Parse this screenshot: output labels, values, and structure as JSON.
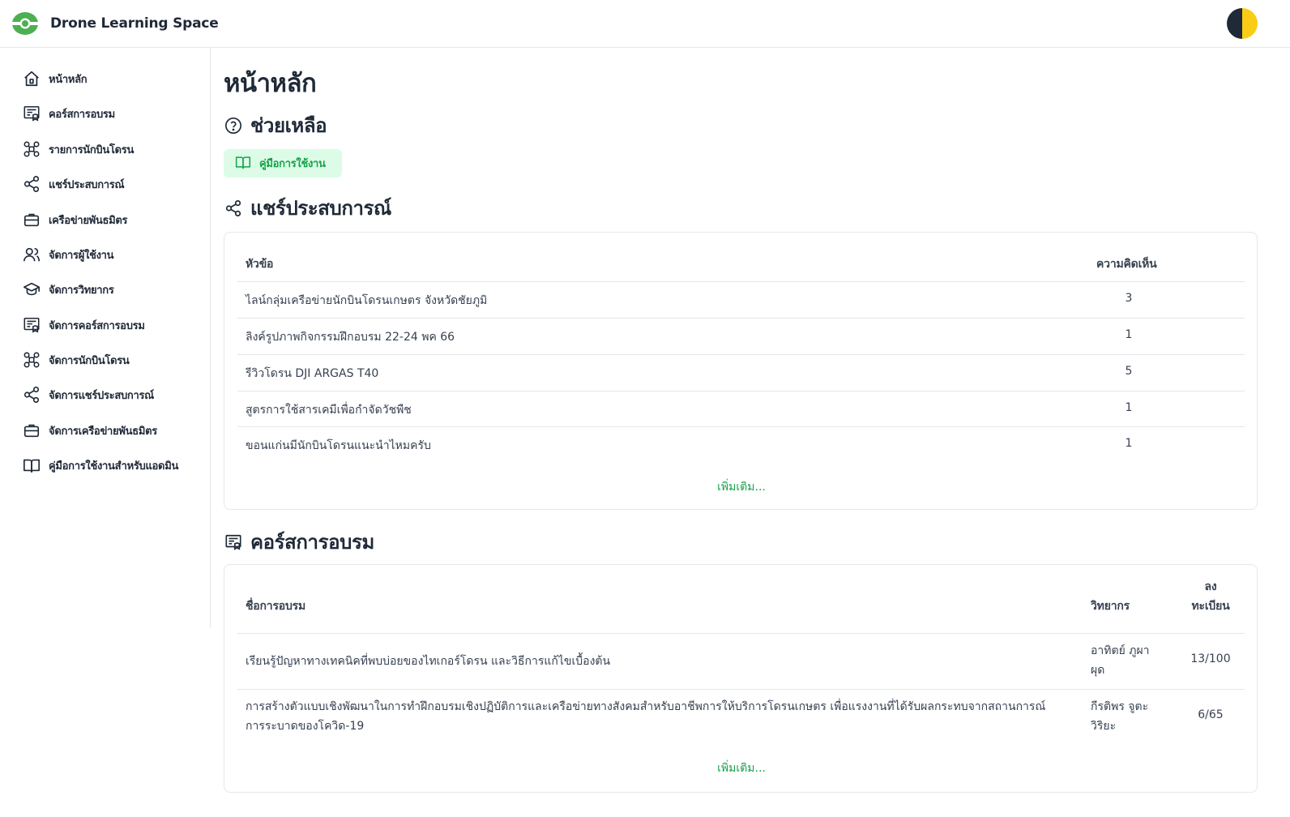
{
  "app": {
    "title": "Drone Learning Space"
  },
  "sidebar": {
    "items": [
      {
        "label": "หน้าหลัก",
        "icon": "home-icon"
      },
      {
        "label": "คอร์สการอบรม",
        "icon": "course-icon"
      },
      {
        "label": "รายการนักบินโดรน",
        "icon": "drone-icon"
      },
      {
        "label": "แชร์ประสบการณ์",
        "icon": "share-icon"
      },
      {
        "label": "เครือข่ายพันธมิตร",
        "icon": "briefcase-icon"
      },
      {
        "label": "จัดการผู้ใช้งาน",
        "icon": "users-icon"
      },
      {
        "label": "จัดการวิทยากร",
        "icon": "graduation-cap-icon"
      },
      {
        "label": "จัดการคอร์สการอบรม",
        "icon": "course-icon"
      },
      {
        "label": "จัดการนักบินโดรน",
        "icon": "drone-icon"
      },
      {
        "label": "จัดการแชร์ประสบการณ์",
        "icon": "share-icon"
      },
      {
        "label": "จัดการเครือข่ายพันธมิตร",
        "icon": "briefcase-icon"
      },
      {
        "label": "คู่มือการใช้งานสำหรับแอดมิน",
        "icon": "book-icon"
      }
    ]
  },
  "main": {
    "page_title": "หน้าหลัก",
    "help": {
      "title": "ช่วยเหลือ",
      "manual_button": "คู่มือการใช้งาน"
    },
    "share": {
      "title": "แชร์ประสบการณ์",
      "columns": {
        "topic": "หัวข้อ",
        "comments": "ความคิดเห็น"
      },
      "rows": [
        {
          "topic": "ไลน์กลุ่มเครือข่ายนักบินโดรนเกษตร จังหวัดชัยภูมิ",
          "comments": "3"
        },
        {
          "topic": "ลิงค์รูปภาพกิจกรรมฝึกอบรม 22-24 พค 66",
          "comments": "1"
        },
        {
          "topic": "รีวิวโดรน DJI ARGAS T40",
          "comments": "5"
        },
        {
          "topic": "สูตรการใช้สารเคมีเพื่อกำจัดวัชพืช",
          "comments": "1"
        },
        {
          "topic": "ขอนแก่นมีนักบินโดรนแนะนำไหมครับ",
          "comments": "1"
        }
      ],
      "more": "เพิ่มเติม..."
    },
    "courses": {
      "title": "คอร์สการอบรม",
      "columns": {
        "name": "ชื่อการอบรม",
        "trainer": "วิทยากร",
        "registered_line1": "ลง",
        "registered_line2": "ทะเบียน"
      },
      "rows": [
        {
          "name": "เรียนรู้ปัญหาทางเทคนิคที่พบบ่อยของไทเกอร์โดรน และวิธีการแก้ไขเบื้องต้น",
          "name2": "",
          "trainer1": "อาทิตย์ ภูผา",
          "trainer2": "ผุด",
          "registered": "13/100"
        },
        {
          "name": "การสร้างตัวแบบเชิงพัฒนาในการทำฝึกอบรมเชิงปฏิบัติการและเครือข่ายทางสังคมสำหรับอาชีพการให้บริการโดรนเกษตร เพื่อแรงงานที่ได้รับผลกระทบจากสถานการณ์",
          "name2": "การระบาดของโควิด-19",
          "trainer1": "กีรติพร จูตะ",
          "trainer2": "วิริยะ",
          "registered": "6/65"
        }
      ],
      "more": "เพิ่มเติม..."
    }
  },
  "colors": {
    "accent": "#16a34a",
    "accent_bg": "#dcfce7",
    "logo": "#4caf50",
    "toggle_dark": "#1f2937",
    "toggle_light": "#facc15"
  }
}
